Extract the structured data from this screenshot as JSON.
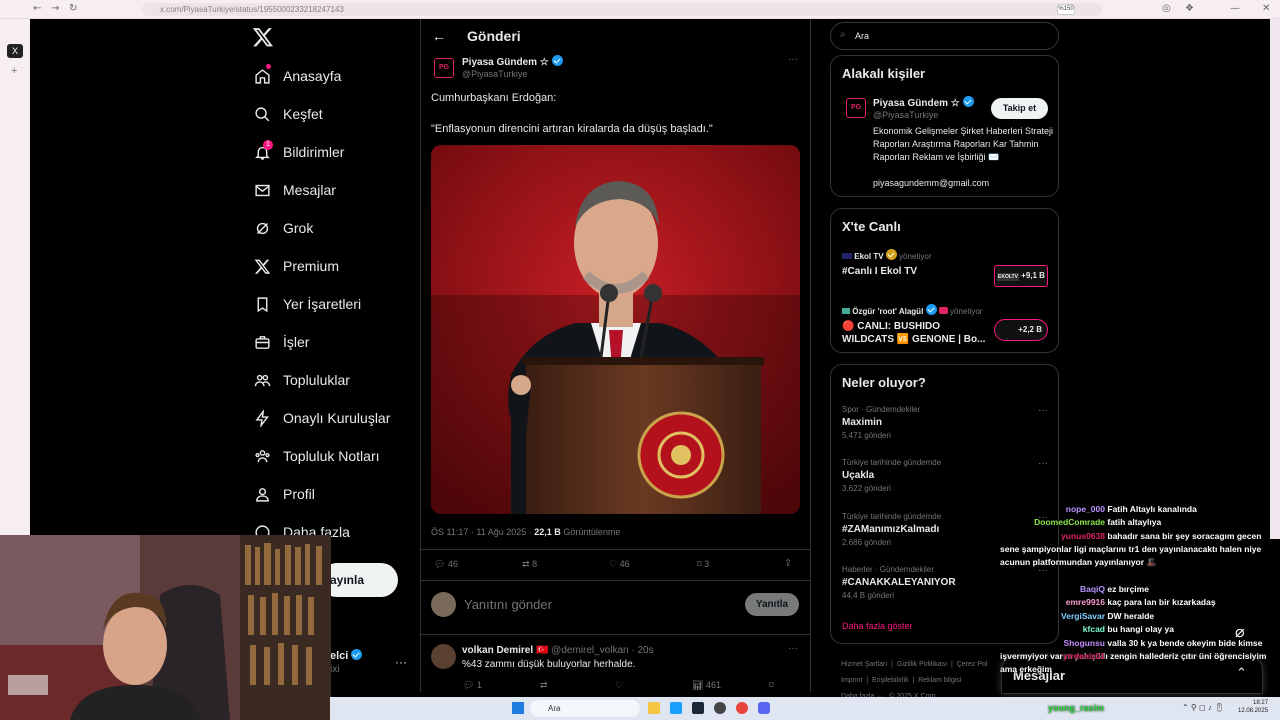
{
  "browser": {
    "url": "x.com/PiyasaTurkiye/status/1955000233218247143",
    "zoom": "%150",
    "back": "←",
    "fwd": "→",
    "reload": "↻",
    "tab_icon": "X",
    "add_tab": "+"
  },
  "nav": {
    "items": [
      {
        "label": "Anasayfa",
        "icon": "home-icon"
      },
      {
        "label": "Keşfet",
        "icon": "search-icon"
      },
      {
        "label": "Bildirimler",
        "icon": "bell-icon",
        "badge": "1"
      },
      {
        "label": "Mesajlar",
        "icon": "mail-icon"
      },
      {
        "label": "Grok",
        "icon": "grok-icon"
      },
      {
        "label": "Premium",
        "icon": "x-icon"
      },
      {
        "label": "Yer İşaretleri",
        "icon": "bookmark-icon"
      },
      {
        "label": "İşler",
        "icon": "briefcase-icon"
      },
      {
        "label": "Topluluklar",
        "icon": "people-icon"
      },
      {
        "label": "Onaylı Kuruluşlar",
        "icon": "lightning-icon"
      },
      {
        "label": "Topluluk Notları",
        "icon": "notes-icon"
      },
      {
        "label": "Profil",
        "icon": "person-icon"
      },
      {
        "label": "Daha fazla",
        "icon": "more-icon"
      }
    ],
    "post_button": "ayınla",
    "account_name": "elci",
    "account_handle": "ixi",
    "account_more": "···"
  },
  "header": {
    "title": "Gönderi",
    "back": "←"
  },
  "post": {
    "author": "Piyasa Gündem ☆",
    "handle": "@PiyasaTurkiye",
    "avatar": "PG",
    "text_line1": "Cumhurbaşkanı Erdoğan:",
    "text_line2": "\"Enflasyonun direncini artıran kiralarda da düşüş başladı.\"",
    "time": "ÖS 11:17 · 11 Ağu 2025 ·",
    "views": "22,1 B",
    "views_label": "Görüntülenme",
    "replies": "46",
    "reposts": "8",
    "likes": "46",
    "bookmarks": "3",
    "more": "···"
  },
  "reply_box": {
    "placeholder": "Yanıtını gönder",
    "button": "Yanıtla"
  },
  "comment": {
    "author": "volkan Demirel",
    "flag": "🇹🇷",
    "handle": "@demirel_volkan",
    "age": "· 20s",
    "text": "%43 zammı düşük buluyorlar herhalde.",
    "replies": "1",
    "views": "461",
    "more": "···"
  },
  "search": {
    "placeholder": "Ara"
  },
  "related": {
    "title": "Alakalı kişiler",
    "name": "Piyasa Gündem ☆",
    "handle": "@PiyasaTurkiye",
    "follow": "Takip et",
    "bio": "Ekonomik Gelişmeler Şirket Haberleri Strateji Raporları Araştırma Raporları Kar Tahmin Raporları Reklam ve İşbirliği ✉️",
    "email": "piyasagundemm@gmail.com"
  },
  "live": {
    "title": "X'te Canlı",
    "items": [
      {
        "host": "Ekol TV",
        "role": "yönetiyor",
        "title": "#Canlı I Ekol TV",
        "count": "+9,1 B",
        "thumb": "EKOLTV"
      },
      {
        "host": "Özgür 'root' Alagül",
        "role": "yönetiyor",
        "title": "🔴 CANLI: BUSHIDO WILDCATS 🆚 GENONE | Bo...",
        "count": "+2,2 B"
      }
    ]
  },
  "trends": {
    "title": "Neler oluyor?",
    "items": [
      {
        "context": "Spor · Gündemdekiler",
        "name": "Maximin",
        "count": "5.471 gönderi"
      },
      {
        "context": "Türkiye tarihinde gündemde",
        "name": "Uçakla",
        "count": "3.622 gönderi"
      },
      {
        "context": "Türkiye tarihinde gündemde",
        "name": "#ZAManımızKalmadı",
        "count": "2.686 gönderi"
      },
      {
        "context": "Haberler · Gündemdekiler",
        "name": "#CANAKKALEYANIYOR",
        "count": "44,4 B gönderi"
      }
    ],
    "more": "Daha fazla göster"
  },
  "footer": {
    "links": [
      "Hizmet Şartları",
      "Gizlilik Politikası",
      "Çerez Pol",
      "Imprint",
      "Erişilebilirlik",
      "Reklam bilgisi",
      "Daha fazla ···",
      "© 2025 X Corp."
    ]
  },
  "messages_drawer": {
    "label": "Mesajlar"
  },
  "chat": [
    {
      "user": "nope_000",
      "color": "#b894ff",
      "msg": "Fatih Altaylı kanalında"
    },
    {
      "user": "DoomedComrade",
      "color": "#8be84a",
      "msg": "fatih altaylıya"
    },
    {
      "user": "yunus0638",
      "color": "#e0245e",
      "msg": "bahadır sana bir şey soracagım gecen sene şampiyonlar ligi maçlarını tr1 den yayınlanacaktı halen niye acunun platformundan yayınlanıyor 🎩"
    },
    {
      "user": "BaqiQ",
      "color": "#b894ff",
      "msg": "ez bırçime"
    },
    {
      "user": "emre9916",
      "color": "#ff9ccf",
      "msg": "kaç para lan bir kızarkadaş"
    },
    {
      "user": "VergiSavar",
      "color": "#7fd4ff",
      "msg": "DW heralde"
    },
    {
      "user": "kfcad",
      "color": "#7fffd4",
      "msg": "bu hangi olay ya"
    },
    {
      "user": "Shogunsu",
      "color": "#c58cff",
      "msg": "valla 30 k ya bende okeyim bide kimse işvermyiyor varsa yakışıklı zengin hallederiz çıtır üni öğrencisiyim ama erkeğim"
    },
    {
      "user": "ytrdeniz01",
      "color": "#e0245e",
      "msg": ""
    }
  ],
  "chat_footer_user": "young_rasim",
  "taskbar": {
    "search": "Ara",
    "time": "18:27",
    "date": "12.08.2025"
  },
  "colors": {
    "bg": "#000000",
    "text": "#e7e9ea",
    "muted": "#71767b",
    "accent": "#1d9bf0",
    "pink": "#f91880"
  }
}
